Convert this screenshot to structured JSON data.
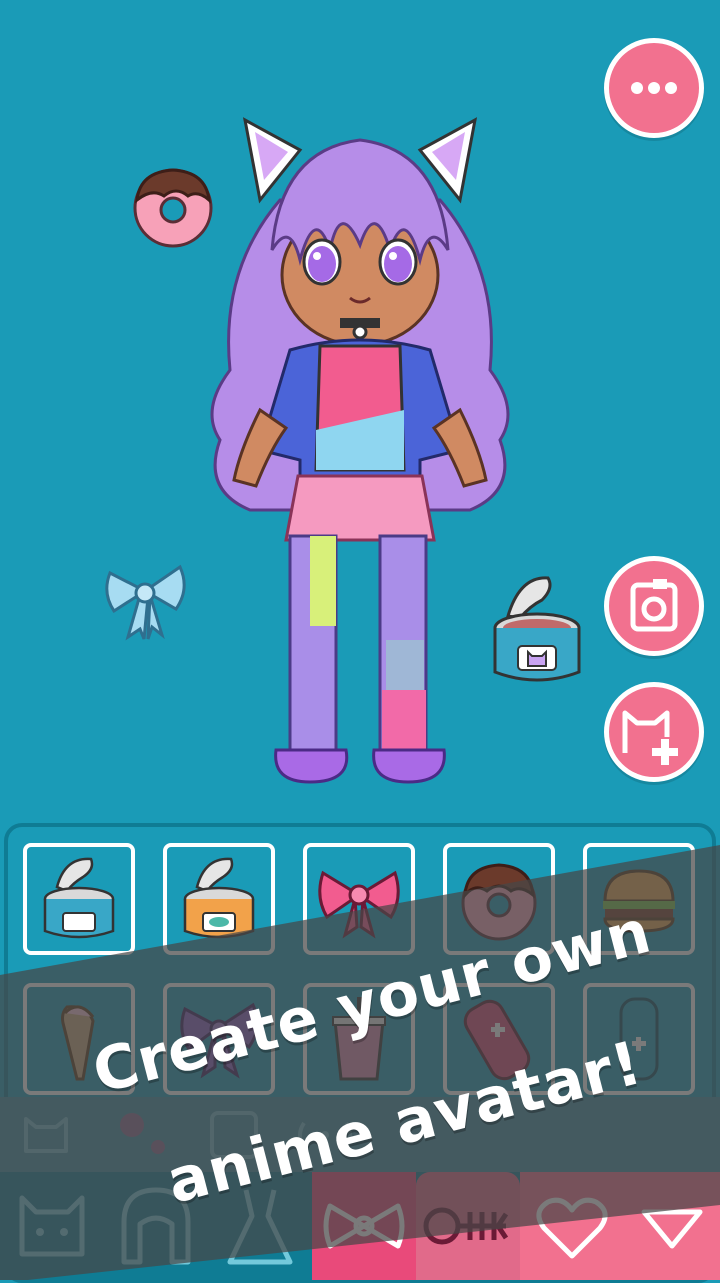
{
  "banner": {
    "line1": "Create your own",
    "line2": "anime avatar!"
  },
  "colors": {
    "background": "#1a9bb7",
    "accent_pink": "#f2718f",
    "panel_border": "#0f7c94",
    "slot_border": "#ffffff"
  },
  "top_buttons": {
    "menu_icon": "more-dots-icon",
    "camera_icon": "camera-icon",
    "new_avatar_icon": "cat-plus-icon"
  },
  "stage_items": [
    "donut",
    "bow",
    "cat-food-can"
  ],
  "item_grid": [
    {
      "name": "cat-food-can-pink",
      "icon": "can-icon"
    },
    {
      "name": "cat-food-can-fish",
      "icon": "can-icon"
    },
    {
      "name": "pink-bow",
      "icon": "bow-icon"
    },
    {
      "name": "donut",
      "icon": "donut-icon"
    },
    {
      "name": "burger",
      "icon": "burger-icon"
    },
    {
      "name": "ice-cream-cone",
      "icon": "cone-icon"
    },
    {
      "name": "purple-bow",
      "icon": "bow-icon"
    },
    {
      "name": "drink-cup",
      "icon": "cup-icon"
    },
    {
      "name": "game-controller-left",
      "icon": "controller-icon"
    },
    {
      "name": "game-controller-right",
      "icon": "controller-icon"
    }
  ],
  "category_icons": [
    "cat-face-icon",
    "sparkle-icon",
    "frame-icon",
    "sound-icon"
  ],
  "tabs": [
    {
      "name": "tab-body",
      "icon": "cat-face-icon",
      "active": false
    },
    {
      "name": "tab-hair",
      "icon": "hair-icon",
      "active": false
    },
    {
      "name": "tab-dress",
      "icon": "dress-icon",
      "active": false
    },
    {
      "name": "tab-accessory",
      "icon": "bow-icon",
      "active": false
    },
    {
      "name": "tab-items",
      "icon": "fish-bone-icon",
      "active": true
    },
    {
      "name": "tab-favorites",
      "icon": "heart-icon",
      "active": false
    },
    {
      "name": "tab-collapse",
      "icon": "triangle-down-icon",
      "active": false
    }
  ]
}
